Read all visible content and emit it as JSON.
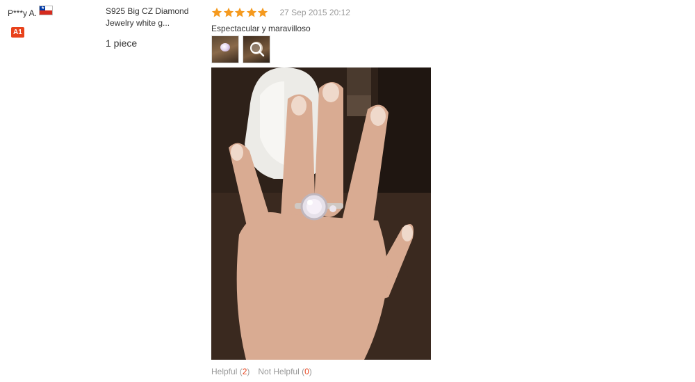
{
  "reviewer": {
    "name": "P***y A.",
    "flag_icon": "chile-flag-icon",
    "level_badge": "A1"
  },
  "product": {
    "title_line1": "S925 Big CZ Diamond",
    "title_line2": "Jewelry white g...",
    "quantity": "1 piece"
  },
  "review": {
    "rating": 5,
    "date": "27 Sep 2015 20:12",
    "text": "Espectacular y maravilloso",
    "star_color": "#f59a1f"
  },
  "helpful": {
    "helpful_label": "Helpful (",
    "helpful_count": "2",
    "helpful_close": ")",
    "not_helpful_label": "Not Helpful (",
    "not_helpful_count": "0",
    "not_helpful_close": ")",
    "count_color": "#e8421b"
  }
}
